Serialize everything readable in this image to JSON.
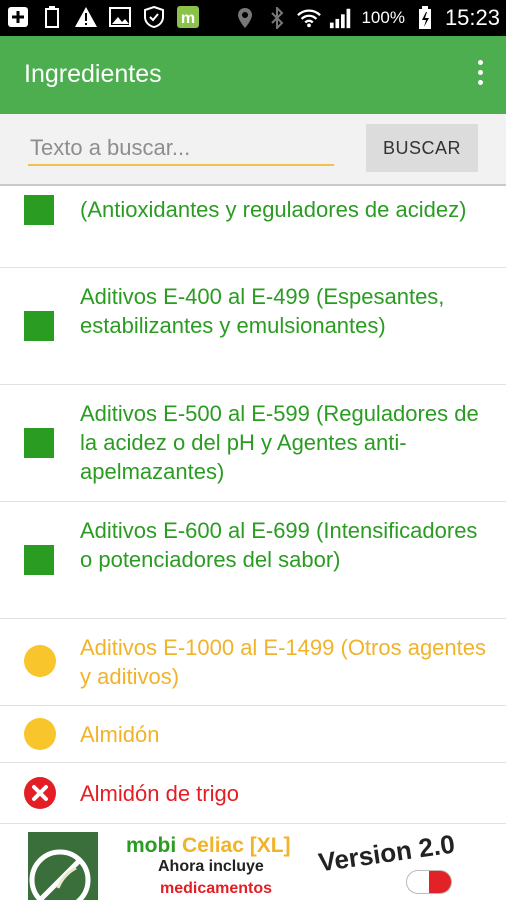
{
  "status_bar": {
    "battery": "100%",
    "time": "15:23",
    "icons": [
      "add-icon",
      "battery-outline-icon",
      "warning-icon",
      "image-icon",
      "shield-icon",
      "app-m-icon",
      "location-icon",
      "bluetooth-icon",
      "wifi-icon",
      "signal-icon",
      "battery-icon"
    ]
  },
  "app_bar": {
    "title": "Ingredientes",
    "menu_icon": "more-vert-icon"
  },
  "search": {
    "placeholder": "Texto a buscar...",
    "button_label": "BUSCAR"
  },
  "list": {
    "items": [
      {
        "label": "(Antioxidantes y reguladores de acidez)",
        "marker": "square",
        "color": "#2a9c22"
      },
      {
        "label": "Aditivos E-400 al E-499 (Espesantes, estabilizantes y emulsionantes)",
        "marker": "square",
        "color": "#2a9c22"
      },
      {
        "label": "Aditivos E-500 al E-599 (Reguladores de la acidez o del pH y Agentes anti-apelmazantes)",
        "marker": "square",
        "color": "#2a9c22"
      },
      {
        "label": "Aditivos E-600 al E-699 (Intensificadores o potenciadores del sabor)",
        "marker": "square",
        "color": "#2a9c22"
      },
      {
        "label": "Aditivos E-1000 al E-1499 (Otros agentes y aditivos)",
        "marker": "circle",
        "color": "#f0b32a"
      },
      {
        "label": "Almidón",
        "marker": "circle",
        "color": "#f0b32a"
      },
      {
        "label": "Almidón de trigo",
        "marker": "x-circle",
        "color": "#e31e24"
      }
    ]
  },
  "ad": {
    "brand_mobi": "mobi",
    "brand_celiac": "Celiac [XL]",
    "line1": "Ahora incluye",
    "line2": "medicamentos",
    "version": "Version 2.0"
  },
  "colors": {
    "primary": "#4cae4f",
    "green": "#2a9c22",
    "yellow": "#f0b32a",
    "red": "#e31e24"
  }
}
